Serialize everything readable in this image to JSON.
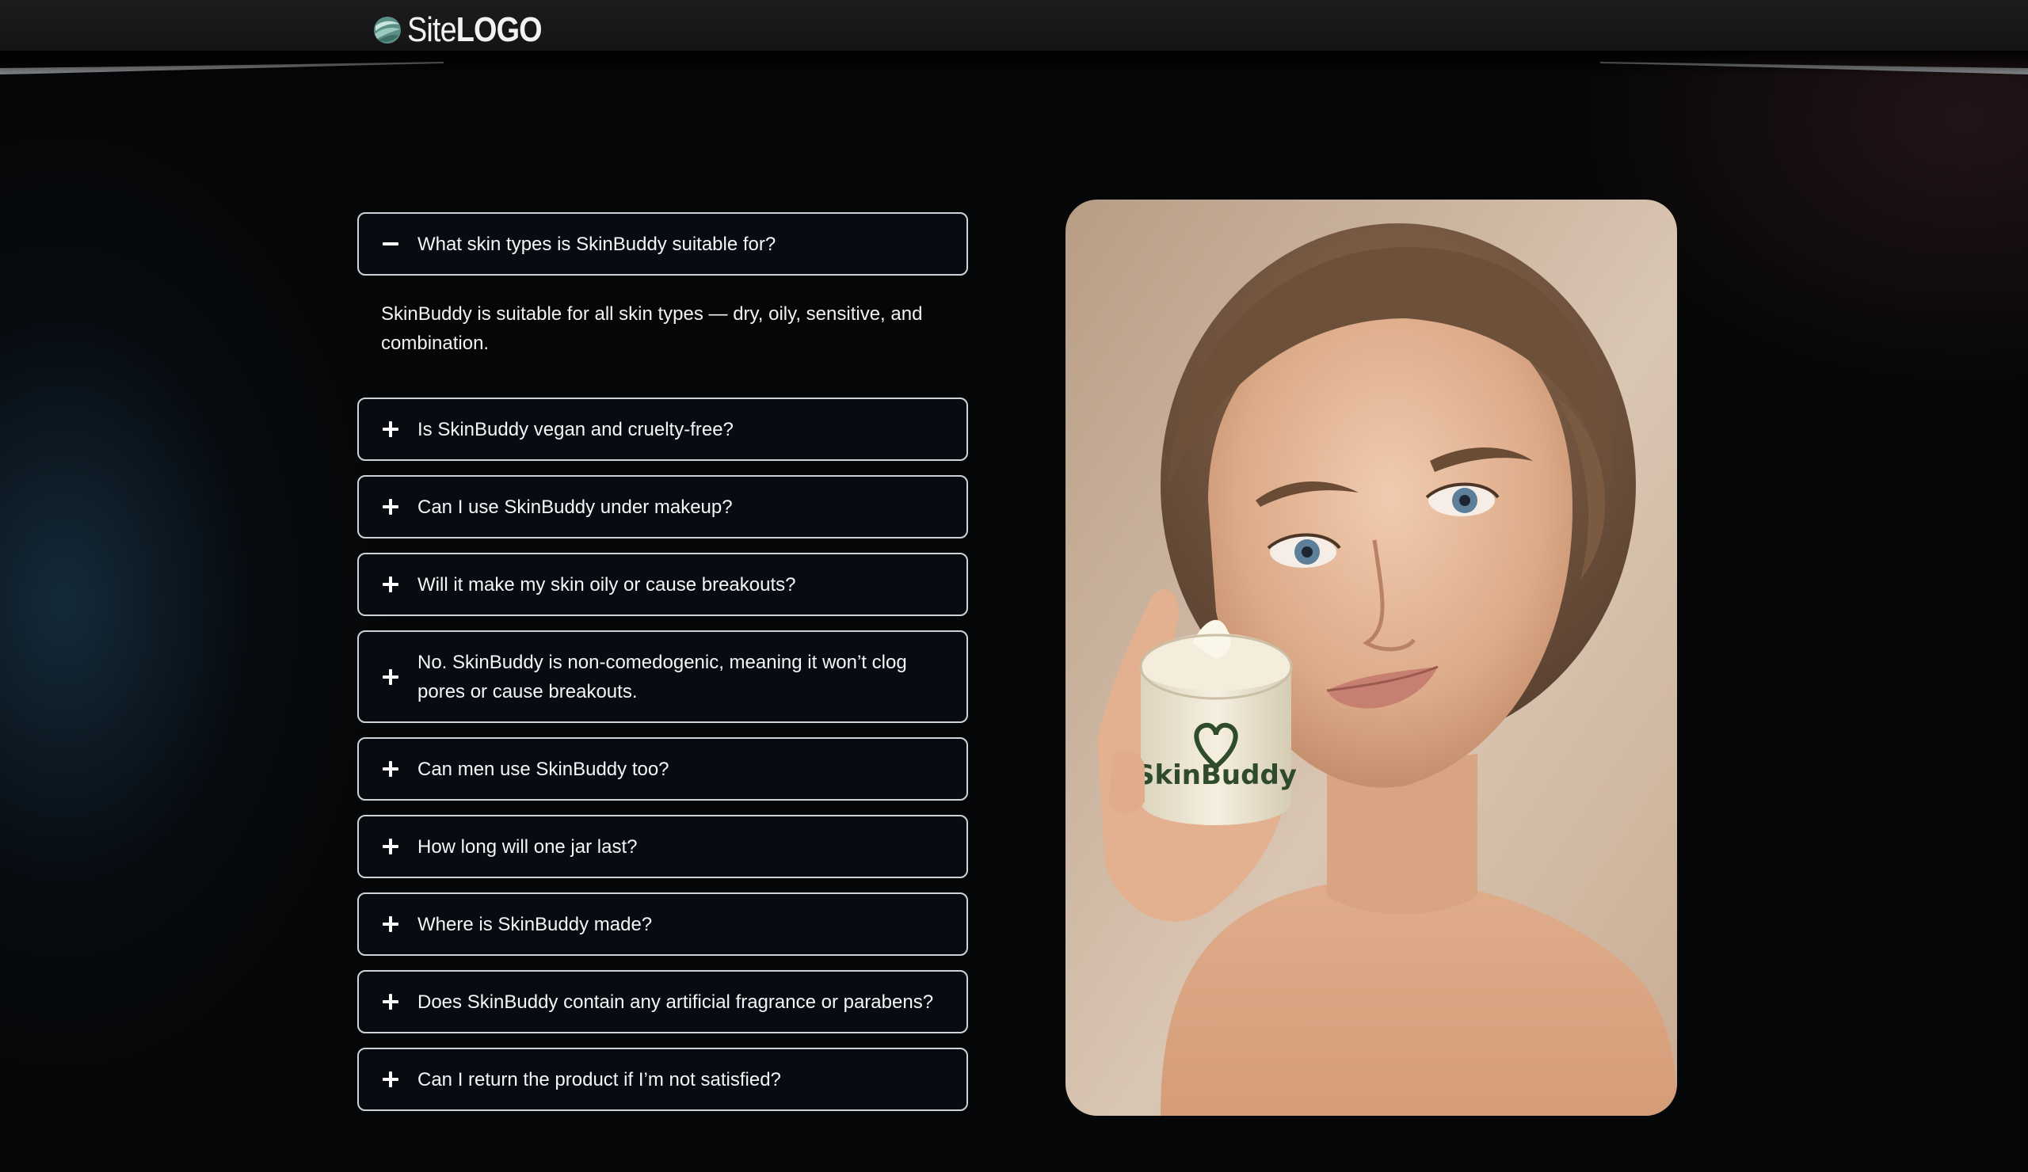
{
  "header": {
    "logo_site": "Site",
    "logo_bold": "LOGO"
  },
  "faq": {
    "items": [
      {
        "question": "What skin types is SkinBuddy suitable for?",
        "expanded": true,
        "answer": "SkinBuddy is suitable for all skin types — dry, oily, sensitive, and combination."
      },
      {
        "question": "Is SkinBuddy vegan and cruelty-free?",
        "expanded": false
      },
      {
        "question": "Can I use SkinBuddy under makeup?",
        "expanded": false
      },
      {
        "question": "Will it make my skin oily or cause breakouts?",
        "expanded": false
      },
      {
        "question": "No. SkinBuddy is non-comedogenic, meaning it won’t clog pores or cause breakouts.",
        "expanded": false
      },
      {
        "question": "Can men use SkinBuddy too?",
        "expanded": false
      },
      {
        "question": "How long will one jar last?",
        "expanded": false
      },
      {
        "question": "Where is SkinBuddy made?",
        "expanded": false
      },
      {
        "question": "Does SkinBuddy contain any artificial fragrance or parabens?",
        "expanded": false
      },
      {
        "question": "Can I return the product if I’m not satisfied?",
        "expanded": false
      }
    ]
  },
  "photo": {
    "jar_brand": "SkinBuddy",
    "icon": "heart-icon"
  },
  "icons": {
    "collapse": "minus-icon",
    "expand": "plus-icon",
    "logo": "globe-logo-icon"
  },
  "colors": {
    "background": "#050607",
    "header": "#1a1a1b",
    "item_border": "#cfd3d8",
    "item_fill": "#080b11",
    "brand_green": "#2f4a2c"
  }
}
